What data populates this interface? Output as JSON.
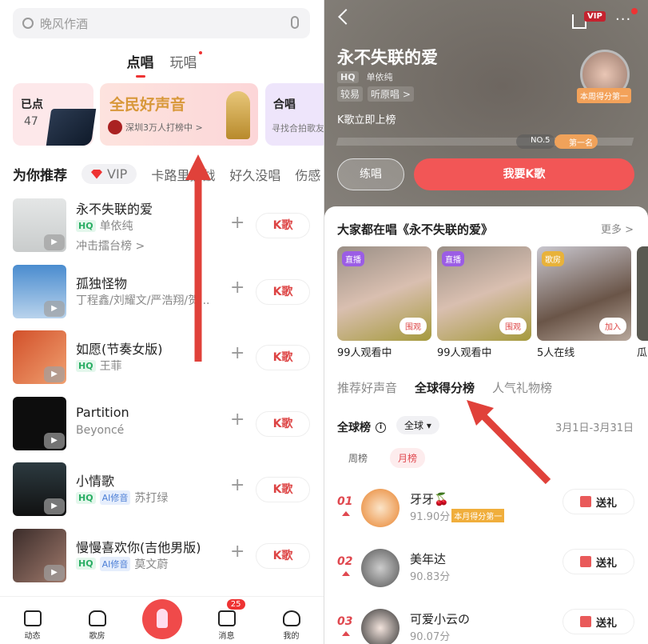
{
  "left": {
    "search": {
      "placeholder": "晚风作酒"
    },
    "tabs": [
      "点唱",
      "玩唱"
    ],
    "cards": {
      "picked": {
        "title": "已点",
        "count": "47"
      },
      "contest": {
        "title": "全民好声音",
        "subtitle": "深圳3万人打榜中 >"
      },
      "duet": {
        "title": "合唱",
        "subtitle": "寻找合拍歌友"
      }
    },
    "rec_bar": {
      "title": "为你推荐",
      "vip": "VIP",
      "cats": [
        "卡路里挑战",
        "好久没唱",
        "伤感"
      ]
    },
    "songs": [
      {
        "title": "永不失联的爱",
        "tags": [
          "HQ"
        ],
        "artist": "单依纯",
        "extra": "冲击擂台榜 >",
        "btn": "K歌"
      },
      {
        "title": "孤独怪物",
        "tags": [],
        "artist": "丁程鑫/刘耀文/严浩翔/贺...",
        "btn": "K歌"
      },
      {
        "title": "如愿(节奏女版)",
        "tags": [
          "HQ"
        ],
        "artist": "王菲",
        "btn": "K歌"
      },
      {
        "title": "Partition",
        "tags": [],
        "artist": "Beyoncé",
        "btn": "K歌"
      },
      {
        "title": "小情歌",
        "tags": [
          "HQ",
          "AI修音"
        ],
        "artist": "苏打绿",
        "btn": "K歌"
      },
      {
        "title": "慢慢喜欢你(吉他男版)",
        "tags": [
          "HQ",
          "AI修音"
        ],
        "artist": "莫文蔚",
        "btn": "K歌"
      }
    ],
    "nav": [
      {
        "label": "动态"
      },
      {
        "label": "歌房"
      },
      {
        "label": ""
      },
      {
        "label": "消息",
        "badge": "25"
      },
      {
        "label": "我的"
      }
    ]
  },
  "right": {
    "vip": "VIP",
    "song_title": "永不失联的爱",
    "hq": "HQ",
    "artist": "单依纯",
    "difficulty": "较易",
    "listen": "听原唱 >",
    "rank_hint": "K歌立即上榜",
    "progress": {
      "no5": "NO.5",
      "first": "第一名"
    },
    "crown_label": "本周得分第一",
    "practice": "练唱",
    "sing": "我要K歌",
    "section_title": "大家都在唱《永不失联的爱》",
    "more": "更多 >",
    "rooms": [
      {
        "badge": "直播",
        "btn": "围观",
        "label": "99人观看中"
      },
      {
        "badge": "直播",
        "btn": "围观",
        "label": "99人观看中"
      },
      {
        "badge": "歌房",
        "btn": "加入",
        "label": "5人在线"
      },
      {
        "label": "瓜"
      }
    ],
    "tabs": [
      "推荐好声音",
      "全球得分榜",
      "人气礼物榜"
    ],
    "board": "全球榜",
    "scope": "全球",
    "date": "3月1日-3月31日",
    "periods": [
      "周榜",
      "月榜"
    ],
    "ranks": [
      {
        "no": "01",
        "name": "牙牙🍒",
        "score": "91.90分",
        "tag": "本月得分第一",
        "btn": "送礼"
      },
      {
        "no": "02",
        "name": "美年达",
        "score": "90.83分",
        "btn": "送礼"
      },
      {
        "no": "03",
        "name": "可爱小云の",
        "score": "90.07分",
        "btn": "送礼"
      }
    ]
  },
  "colors": {
    "accent": "#f25656",
    "annotation_arrow": "#e0413a"
  }
}
